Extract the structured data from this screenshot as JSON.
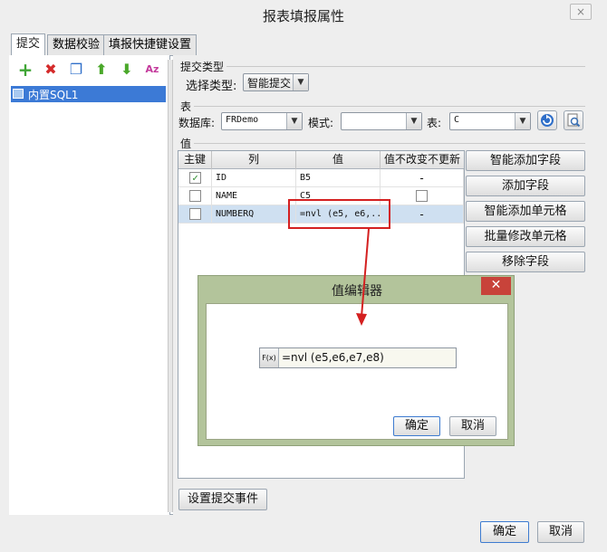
{
  "window": {
    "title": "报表填报属性",
    "close_symbol": "×"
  },
  "tabs": [
    "提交",
    "数据校验",
    "填报快捷键设置"
  ],
  "toolbar": {
    "add": "+",
    "remove": "✖",
    "copy": "❐",
    "up": "⬆",
    "down": "⬇",
    "sort": "Az"
  },
  "tree": {
    "items": [
      {
        "label": "内置SQL1"
      }
    ]
  },
  "submit_type": {
    "section_label": "提交类型",
    "field_label": "选择类型:",
    "value": "智能提交"
  },
  "table_section": {
    "section_label": "表",
    "db_label": "数据库:",
    "db_value": "FRDemo",
    "schema_label": "模式:",
    "schema_value": "",
    "table_label": "表:",
    "table_value": "C"
  },
  "value_section": {
    "section_label": "值",
    "columns": [
      "主键",
      "列",
      "值",
      "值不改变不更新"
    ],
    "rows": [
      {
        "pk": true,
        "column": "ID",
        "value": "B5",
        "nochange": "-"
      },
      {
        "pk": false,
        "column": "NAME",
        "value": "C5",
        "nochange": "checkbox"
      },
      {
        "pk": false,
        "column": "NUMBERQ",
        "value": "=nvl (e5, e6,...",
        "nochange": "-"
      }
    ]
  },
  "side_buttons": [
    "智能添加字段",
    "添加字段",
    "智能添加单元格",
    "批量修改单元格",
    "移除字段"
  ],
  "set_event_button": "设置提交事件",
  "footer": {
    "ok": "确定",
    "cancel": "取消"
  },
  "editor_dialog": {
    "title": "值编辑器",
    "close_symbol": "✕",
    "fx_label": "F(x)",
    "formula": "=nvl (e5,e6,e7,e8)",
    "ok": "确定",
    "cancel": "取消"
  },
  "colors": {
    "selection": "#3c7ad6",
    "highlight_border": "#d42020",
    "dialog_frame": "#b3c49b",
    "dialog_close": "#c8433a"
  }
}
